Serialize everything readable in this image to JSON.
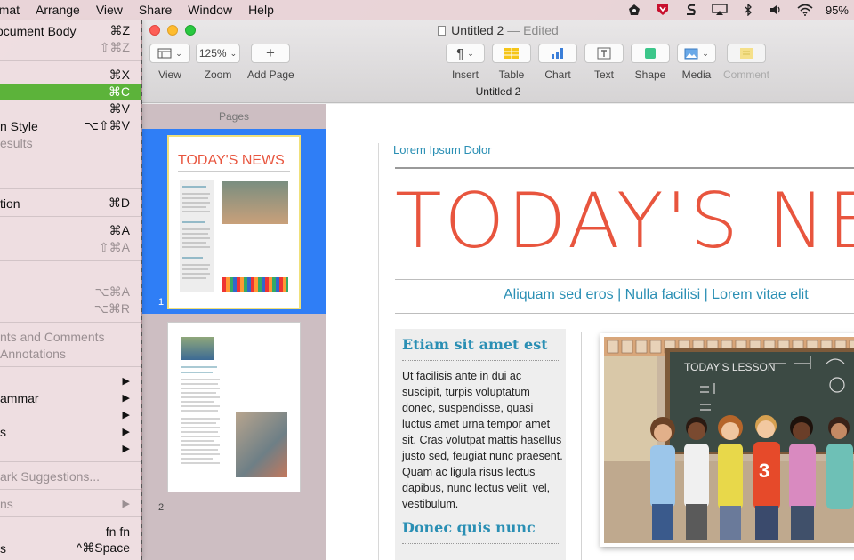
{
  "menubar": {
    "items": [
      "rmat",
      "Arrange",
      "View",
      "Share",
      "Window",
      "Help"
    ],
    "battery": "95%",
    "status_icons": [
      "alfred-icon",
      "mcafee-icon",
      "sync-icon",
      "airplay-icon",
      "bluetooth-icon",
      "volume-icon",
      "wifi-icon"
    ]
  },
  "menu": {
    "r1": {
      "label": "ocument Body",
      "shortcut": "⌘Z"
    },
    "r2": {
      "label": "",
      "shortcut": "⇧⌘Z"
    },
    "r3": {
      "label": "",
      "shortcut": "⌘X"
    },
    "r4": {
      "label": "",
      "shortcut": "⌘C"
    },
    "r5": {
      "label": "",
      "shortcut": "⌘V"
    },
    "r6": {
      "label": "n Style",
      "shortcut": "⌥⇧⌘V"
    },
    "r7": {
      "label": "esults",
      "shortcut": ""
    },
    "r8": {
      "label": "tion",
      "shortcut": "⌘D"
    },
    "r9": {
      "label": "",
      "shortcut": "⌘A"
    },
    "r10": {
      "label": "",
      "shortcut": "⇧⌘A"
    },
    "r11": {
      "label": "",
      "shortcut": "⌥⌘A"
    },
    "r12": {
      "label": "",
      "shortcut": "⌥⌘R"
    },
    "r13": {
      "label": "nts and Comments",
      "shortcut": ""
    },
    "r14": {
      "label": "Annotations",
      "shortcut": ""
    },
    "r15": {
      "label": "",
      "shortcut": "▶"
    },
    "r16": {
      "label": "ammar",
      "shortcut": "▶"
    },
    "r17": {
      "label": "",
      "shortcut": "▶"
    },
    "r18": {
      "label": "s",
      "shortcut": "▶"
    },
    "r19": {
      "label": "",
      "shortcut": "▶"
    },
    "r20": {
      "label": "ark Suggestions...",
      "shortcut": ""
    },
    "r21": {
      "label": "ns",
      "shortcut": "▶"
    },
    "r22": {
      "label": "",
      "shortcut": "fn fn"
    },
    "r23": {
      "label": "s",
      "shortcut": "^⌘Space"
    }
  },
  "window": {
    "title": "Untitled 2",
    "edited": "— Edited",
    "doc_name": "Untitled 2"
  },
  "toolbar": {
    "view": "View",
    "zoom_value": "125%",
    "zoom": "Zoom",
    "add_page": "Add Page",
    "insert": "Insert",
    "table": "Table",
    "chart": "Chart",
    "text": "Text",
    "shape": "Shape",
    "media": "Media",
    "comment": "Comment"
  },
  "sidebar": {
    "header": "Pages",
    "page1_num": "1",
    "page2_num": "2",
    "thumb1_title": "TODAY'S NEWS"
  },
  "document": {
    "top_label": "Lorem Ipsum Dolor",
    "headline": "TODAY'S NEV",
    "subhead": "Aliquam sed eros | Nulla facilisi | Lorem vitae elit",
    "box_heading": "Etiam sit amet est",
    "box_body": "Ut facilisis ante in dui ac suscipit, turpis voluptatum donec, suspendisse, quasi luctus amet urna tempor amet sit. Cras volutpat mattis hasellus justo sed, feugiat nunc praesent. Quam ac ligula risus lectus dapibus, nunc lectus velit, vel, vestibulum.",
    "box_heading2": "Donec quis nunc",
    "chalk_text": "TODAY'S LESSON",
    "jersey_number": "3"
  },
  "colors": {
    "accent_blue": "#2a8fb4",
    "headline_red": "#e8553e",
    "selection_blue": "#2f7ef6",
    "highlight_green": "#5cb33a"
  }
}
